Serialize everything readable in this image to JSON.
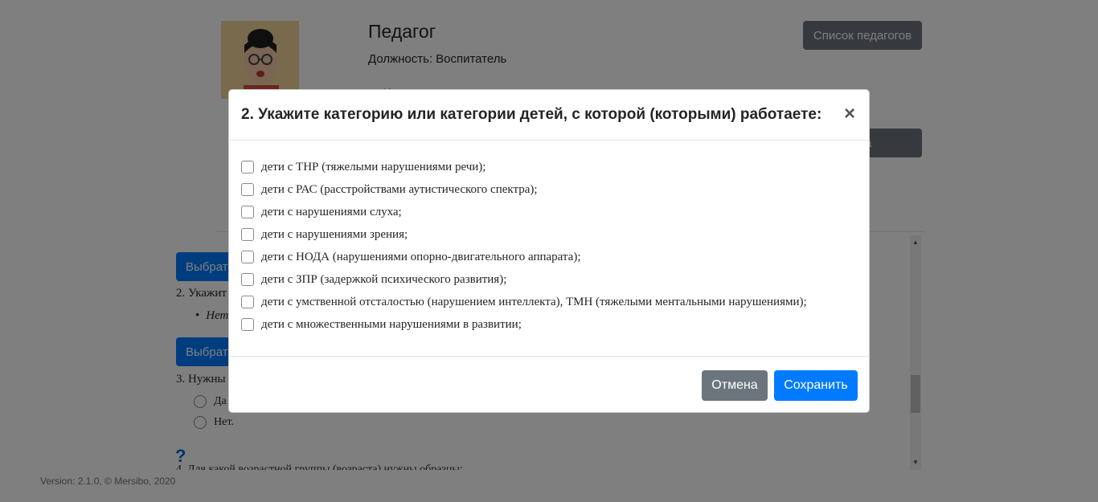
{
  "header": {
    "title": "Педагог",
    "position_label": "Должность:",
    "position_value": "Воспитатель",
    "teachers_list_button": "Список педагогов",
    "partial_line": "И",
    "secondary_button_partial": "а"
  },
  "background_form": {
    "choose_button_partial": "Выбрат",
    "q2_partial": "2. Укажит",
    "q2_answer_partial": "Нет",
    "q3_partial": "3. Нужны",
    "radio_options": [
      "Да",
      "Нет."
    ],
    "help_icon": "?",
    "q4_partial": "4. Для какой возрастной группы (возраста) нужны образцы:"
  },
  "footer": {
    "version": "Version: 2.1.0, © Mersibo, 2020"
  },
  "modal": {
    "title": "2. Укажите категорию или категории детей, с которой (которыми) работаете:",
    "close_symbol": "×",
    "options": [
      "дети с ТНР (тяжелыми нарушениями речи);",
      "дети с РАС (расстройствами аутистического спектра);",
      "дети с нарушениями слуха;",
      "дети с нарушениями зрения;",
      "дети с НОДА (нарушениями опорно-двигательного аппарата);",
      "дети с ЗПР (задержкой психического развития);",
      "дети с умственной отсталостью (нарушением интеллекта), ТМН (тяжелыми ментальными нарушениями);",
      "дети с множественными нарушениями в развитии;"
    ],
    "cancel_label": "Отмена",
    "save_label": "Сохранить"
  },
  "colors": {
    "primary": "#007bff",
    "secondary": "#6c757d",
    "backdrop": "rgba(0,0,0,0.5)"
  }
}
